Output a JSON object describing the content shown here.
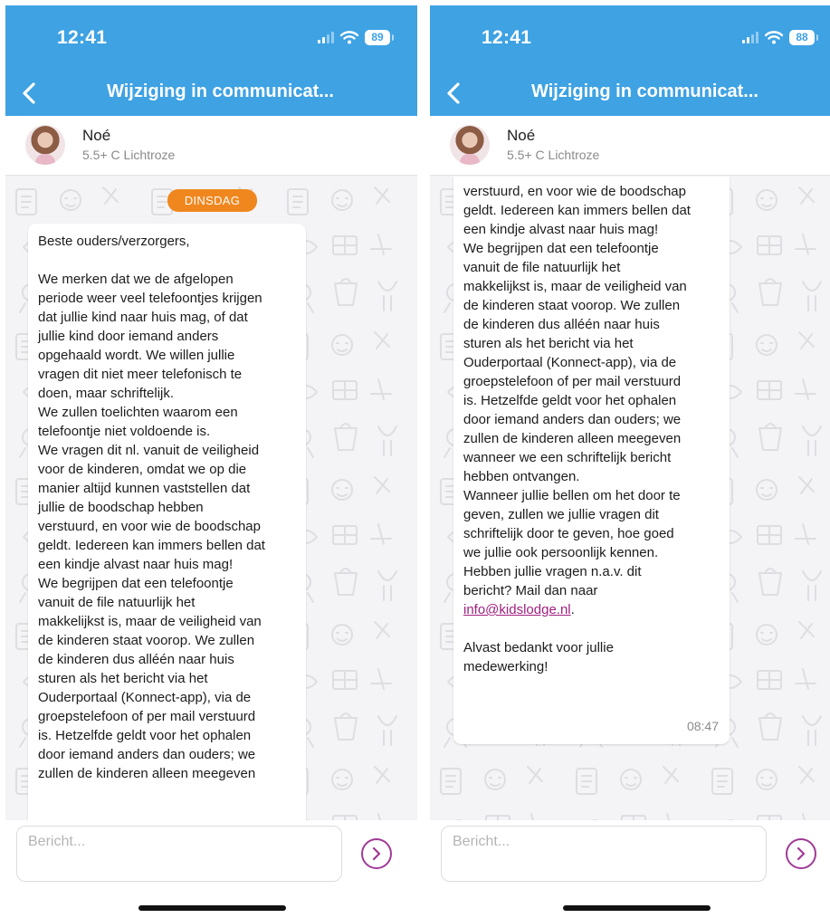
{
  "colors": {
    "header": "#3ea2e3",
    "day_badge": "#f0871e",
    "send_accent": "#a03a96",
    "link": "#a0207e"
  },
  "screens": [
    {
      "status": {
        "time": "12:41",
        "battery": "89"
      },
      "header": {
        "title": "Wijziging in communicat...",
        "back_icon": "chevron-left-icon"
      },
      "contact": {
        "name": "Noé",
        "group": "5.5+ C Lichtroze"
      },
      "day_badge": "DINSDAG",
      "message": {
        "lines": [
          "Beste ouders/verzorgers,",
          "",
          "We merken dat we de afgelopen",
          "periode weer veel telefoontjes krijgen",
          "dat jullie kind naar huis mag, of dat",
          "jullie kind door iemand anders",
          "opgehaald wordt. We willen jullie",
          "vragen dit niet meer telefonisch te",
          "doen, maar schriftelijk.",
          "We zullen toelichten waarom een",
          "telefoontje niet voldoende is.",
          "We vragen dit nl. vanuit de veiligheid",
          "voor de kinderen, omdat we op die",
          "manier altijd kunnen vaststellen dat",
          "jullie de boodschap hebben",
          "verstuurd, en voor wie de boodschap",
          "geldt. Iedereen kan immers bellen dat",
          "een kindje alvast naar huis mag!",
          "We begrijpen dat een telefoontje",
          "vanuit de file natuurlijk het",
          "makkelijkst is, maar de veiligheid van",
          "de kinderen staat voorop. We zullen",
          "de kinderen dus alléén naar huis",
          "sturen als het bericht via het",
          "Ouderportaal (Konnect-app), via de",
          "groepstelefoon of per mail verstuurd",
          "is. Hetzelfde geldt voor het ophalen",
          "door iemand anders dan ouders; we",
          "zullen de kinderen alleen meegeven"
        ]
      },
      "composer": {
        "placeholder": "Bericht...",
        "send_icon": "chevron-right-circle-icon"
      }
    },
    {
      "status": {
        "time": "12:41",
        "battery": "88"
      },
      "header": {
        "title": "Wijziging in communicat...",
        "back_icon": "chevron-left-icon"
      },
      "contact": {
        "name": "Noé",
        "group": "5.5+ C Lichtroze"
      },
      "message": {
        "lines": [
          "verstuurd, en voor wie de boodschap",
          "geldt. Iedereen kan immers bellen dat",
          "een kindje alvast naar huis mag!",
          "We begrijpen dat een telefoontje",
          "vanuit de file natuurlijk het",
          "makkelijkst is, maar de veiligheid van",
          "de kinderen staat voorop. We zullen",
          "de kinderen dus alléén naar huis",
          "sturen als het bericht via het",
          "Ouderportaal (Konnect-app), via de",
          "groepstelefoon of per mail verstuurd",
          "is. Hetzelfde geldt voor het ophalen",
          "door iemand anders dan ouders; we",
          "zullen de kinderen alleen meegeven",
          "wanneer we een schriftelijk bericht",
          "hebben ontvangen.",
          "Wanneer jullie bellen om het door te",
          "geven, zullen we jullie vragen dit",
          "schriftelijk door te geven, hoe goed",
          "we jullie ook persoonlijk kennen.",
          "Hebben jullie vragen n.a.v. dit",
          "bericht? Mail dan naar"
        ],
        "email": "info@kidslodge.nl",
        "email_suffix": ".",
        "closing": [
          "",
          "Alvast bedankt voor jullie",
          "medewerking!"
        ],
        "time": "08:47"
      },
      "composer": {
        "placeholder": "Bericht...",
        "send_icon": "chevron-right-circle-icon"
      }
    }
  ]
}
